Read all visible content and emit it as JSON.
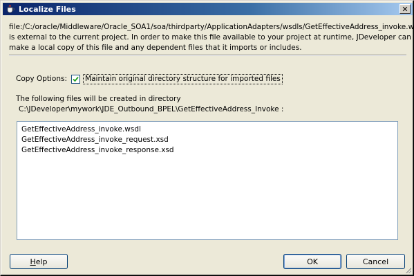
{
  "window": {
    "title": "Localize Files",
    "close_glyph": "✕"
  },
  "message": {
    "line1": "file:/C:/oracle/Middleware/Oracle_SOA1/soa/thirdparty/ApplicationAdapters/wsdls/GetEffectiveAddress_invoke.wsdl",
    "line2": "is external to the current project. In order to make this file available to your project at runtime, JDeveloper can now",
    "line3": "make a local copy of this file and any dependent files that it imports or includes."
  },
  "copy_options": {
    "label": "Copy Options:",
    "checkbox_label": "Maintain original directory structure for imported files",
    "checked": true
  },
  "target": {
    "intro": "The following files will be created in directory",
    "path": "C:\\JDeveloper\\mywork\\JDE_Outbound_BPEL\\GetEffectiveAddress_Invoke :"
  },
  "files": [
    "GetEffectiveAddress_invoke.wsdl",
    "GetEffectiveAddress_invoke_request.xsd",
    "GetEffectiveAddress_invoke_response.xsd"
  ],
  "buttons": {
    "help_mnemonic": "H",
    "help_rest": "elp",
    "ok": "OK",
    "cancel": "Cancel"
  },
  "colors": {
    "titlebar_start": "#0a246a",
    "dialog_bg": "#ece9d8",
    "check_color": "#21a121"
  },
  "icons": {
    "app": "jdeveloper-cup-icon",
    "close": "close-icon",
    "check": "checkmark-icon"
  }
}
